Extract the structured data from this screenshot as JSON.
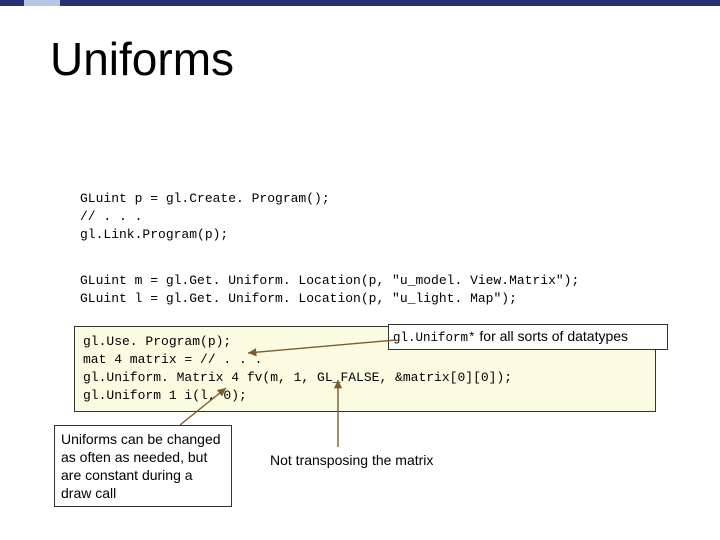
{
  "title": "Uniforms",
  "code_block_1": {
    "l1": "GLuint p = gl.Create. Program();",
    "l2": "// . . .",
    "l3": "gl.Link.Program(p);"
  },
  "code_block_2": {
    "l1": "GLuint m = gl.Get. Uniform. Location(p, \"u_model. View.Matrix\");",
    "l2": "GLuint l = gl.Get. Uniform. Location(p, \"u_light. Map\");"
  },
  "code_box": {
    "l1": "gl.Use. Program(p);",
    "l2": "mat 4 matrix = // . . .",
    "l3": "gl.Uniform. Matrix 4 fv(m, 1, GL_FALSE, &matrix[0][0]);",
    "l4": "gl.Uniform 1 i(l, 0);"
  },
  "callouts": {
    "datatypes_prefix": "gl.Uniform*",
    "datatypes_suffix": " for all sorts of datatypes",
    "transpose": "Not transposing the matrix",
    "changed": "Uniforms can be changed as often as needed, but are constant during a draw call"
  }
}
